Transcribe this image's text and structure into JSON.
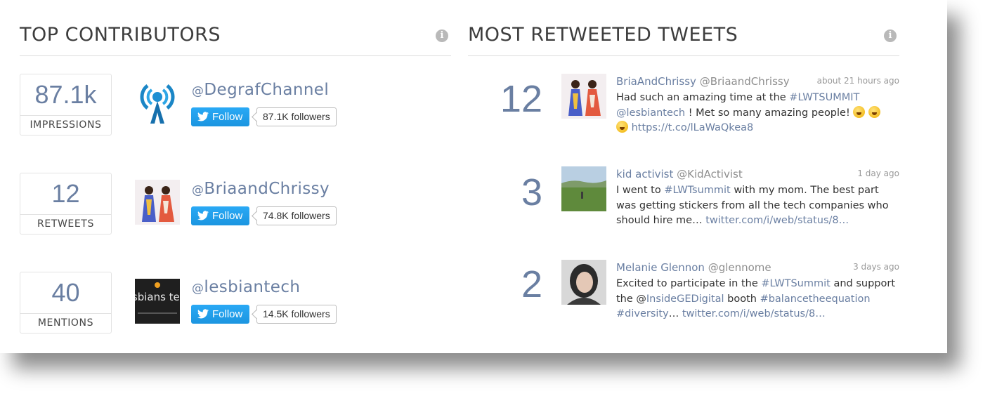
{
  "top_contributors": {
    "title": "TOP CONTRIBUTORS",
    "stats": [
      {
        "value": "87.1k",
        "label": "IMPRESSIONS"
      },
      {
        "value": "12",
        "label": "RETWEETS"
      },
      {
        "value": "40",
        "label": "MENTIONS"
      }
    ],
    "contributors": [
      {
        "at": "@",
        "handle": "DegrafChannel",
        "follow_label": "Follow",
        "followers": "87.1K followers",
        "avatar_icon": "radio-tower-icon"
      },
      {
        "at": "@",
        "handle": "BriaandChrissy",
        "follow_label": "Follow",
        "followers": "74.8K followers",
        "avatar_icon": "two-women-photo"
      },
      {
        "at": "@",
        "handle": "lesbiantech",
        "follow_label": "Follow",
        "followers": "14.5K followers",
        "avatar_icon": "lesbians-tech-logo",
        "avatar_text": "lesbians tech"
      }
    ]
  },
  "most_retweeted": {
    "title": "MOST RETWEETED TWEETS",
    "tweets": [
      {
        "count": "12",
        "name": "BriaAndChrissy",
        "screen_name": "@BriaandChrissy",
        "time": "about 21 hours ago",
        "text": {
          "t1": "Had such an amazing time at the ",
          "l1": "#LWTSUMMIT",
          "t2": "",
          "l2": "@lesbiantech",
          "t3": " ! Met so many amazing people! ",
          "l3": "https://t.co/lLaWaQkea8"
        }
      },
      {
        "count": "3",
        "name": "kid activist",
        "screen_name": "@KidActivist",
        "time": "1 day ago",
        "text": {
          "t1": "I went to ",
          "l1": "#LWTsummit",
          "t2": " with my mom. The best part was getting stickers from all the tech companies who should hire me… ",
          "l2": "twitter.com/i/web/status/8…"
        }
      },
      {
        "count": "2",
        "name": "Melanie Glennon",
        "screen_name": "@glennome",
        "time": "3 days ago",
        "text": {
          "t1": "Excited to participate in the ",
          "l1": "#LWTSummit",
          "t2": " and support the @",
          "l2": "InsideGEDigital",
          "t3": " booth ",
          "l3": "#balancetheequation",
          "t4": " ",
          "l4": "#diversity",
          "t5": "… ",
          "l5": "twitter.com/i/web/status/8…"
        }
      }
    ]
  },
  "colors": {
    "accent": "#6a7fa2",
    "twitter_blue": "#1da1f2",
    "title_text": "#3d3d3d"
  }
}
